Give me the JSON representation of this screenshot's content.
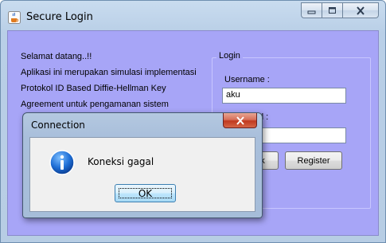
{
  "window": {
    "title": "Secure Login",
    "icon": "java-cup-icon"
  },
  "welcome": {
    "lines": [
      "Selamat datang..!!",
      "Aplikasi ini merupakan simulasi implementasi",
      "Protokol ID Based Diffie-Hellman Key",
      "Agreement untuk pengamanan sistem"
    ]
  },
  "login": {
    "legend": "Login",
    "username_label": "Username :",
    "username_value": "aku",
    "password_label_partial": "d :",
    "password_value": "",
    "login_button_partial": "k",
    "register_label": "Register"
  },
  "dialog": {
    "title": "Connection",
    "message": "Koneksi gagal",
    "ok_label": "OK",
    "icon": "info-icon"
  },
  "colors": {
    "client_background": "#a7a5f7",
    "dialog_close": "#c0391f"
  }
}
